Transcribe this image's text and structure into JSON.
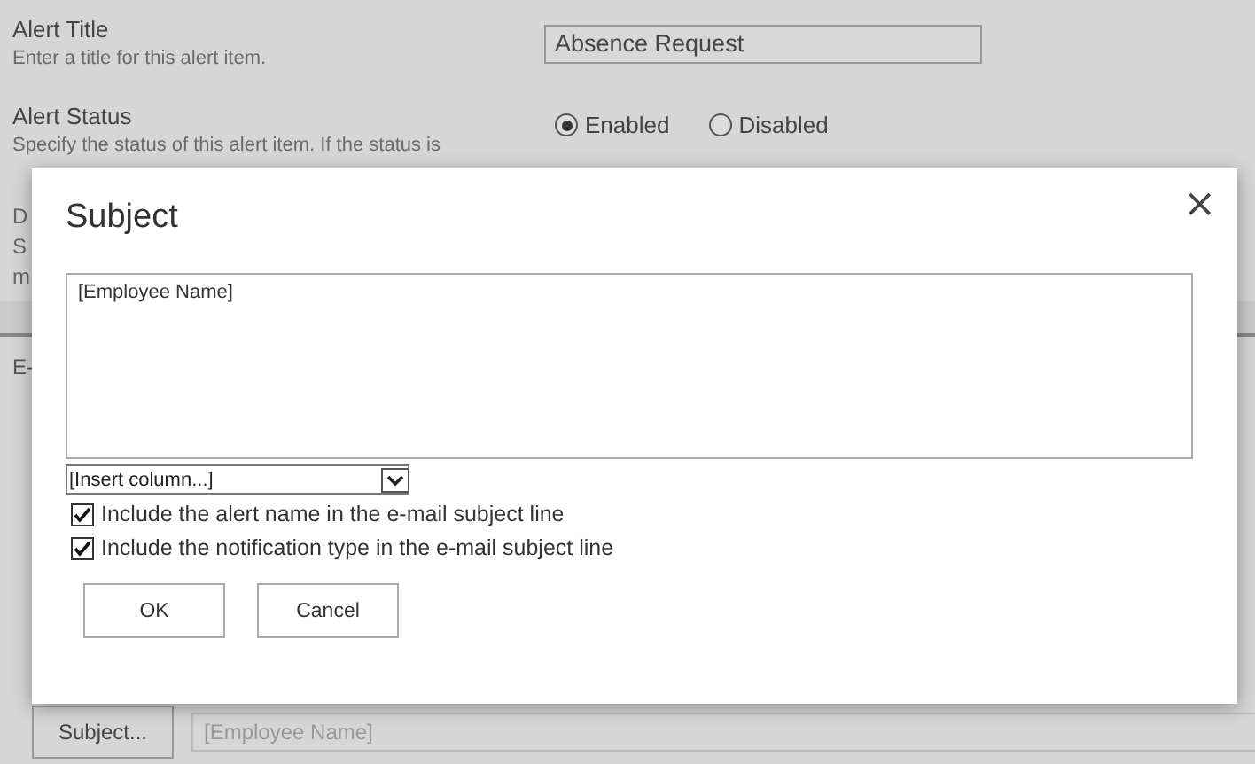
{
  "page": {
    "sections": [
      {
        "kind": "title",
        "label": "Alert Title",
        "description": "Enter a title for this alert item.",
        "value": "Absence Request"
      },
      {
        "kind": "status",
        "label": "Alert Status",
        "description": "Specify the status of this alert item. If the status is",
        "options": [
          {
            "label": "Enabled",
            "selected": true
          },
          {
            "label": "Disabled",
            "selected": false
          }
        ]
      }
    ],
    "cut_texts": [
      "D",
      "S",
      "m"
    ],
    "cut_heading": "E-",
    "subject_button": "Subject...",
    "subject_field": "[Employee Name]"
  },
  "dialog": {
    "title": "Subject",
    "close": "×",
    "text": "[Employee Name]",
    "insert_column": "[Insert column...]",
    "options": [
      {
        "label": "Include the alert name in the e-mail subject line",
        "checked": true
      },
      {
        "label": "Include the notification type in the e-mail subject line",
        "checked": true
      }
    ],
    "buttons": [
      "OK",
      "Cancel"
    ]
  }
}
